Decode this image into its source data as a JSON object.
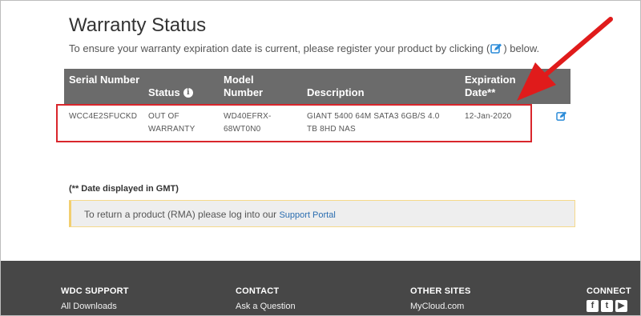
{
  "page": {
    "title": "Warranty Status",
    "intro_before": "To ensure your warranty expiration date is current, please register your product by clicking (",
    "intro_after": ") below."
  },
  "table": {
    "headers": {
      "serial": "Serial Number",
      "status": "Status",
      "model": "Model Number",
      "description": "Description",
      "expiration": "Expiration Date**"
    },
    "rows": [
      {
        "serial": "WCC4E2SFUCKD",
        "status": "OUT OF WARRANTY",
        "model": "WD40EFRX-68WT0N0",
        "description": "GIANT 5400 64M SATA3 6GB/S 4.0 TB 8HD NAS",
        "expiration": "12-Jan-2020"
      }
    ]
  },
  "footnote": "(** Date displayed in GMT)",
  "notice": {
    "text": "To return a product (RMA) please log into our",
    "link": "Support Portal"
  },
  "footer": {
    "columns": [
      {
        "heading": "WDC SUPPORT",
        "link": "All Downloads"
      },
      {
        "heading": "CONTACT",
        "link": "Ask a Question"
      },
      {
        "heading": "OTHER SITES",
        "link": "MyCloud.com"
      },
      {
        "heading": "CONNECT"
      }
    ],
    "social": [
      "facebook-icon",
      "twitter-icon",
      "youtube-icon"
    ]
  },
  "colors": {
    "header_bg": "#6b6b6b",
    "accent_link": "#2a6db0",
    "highlight_red": "#d9262c",
    "footer_bg": "#474747"
  }
}
